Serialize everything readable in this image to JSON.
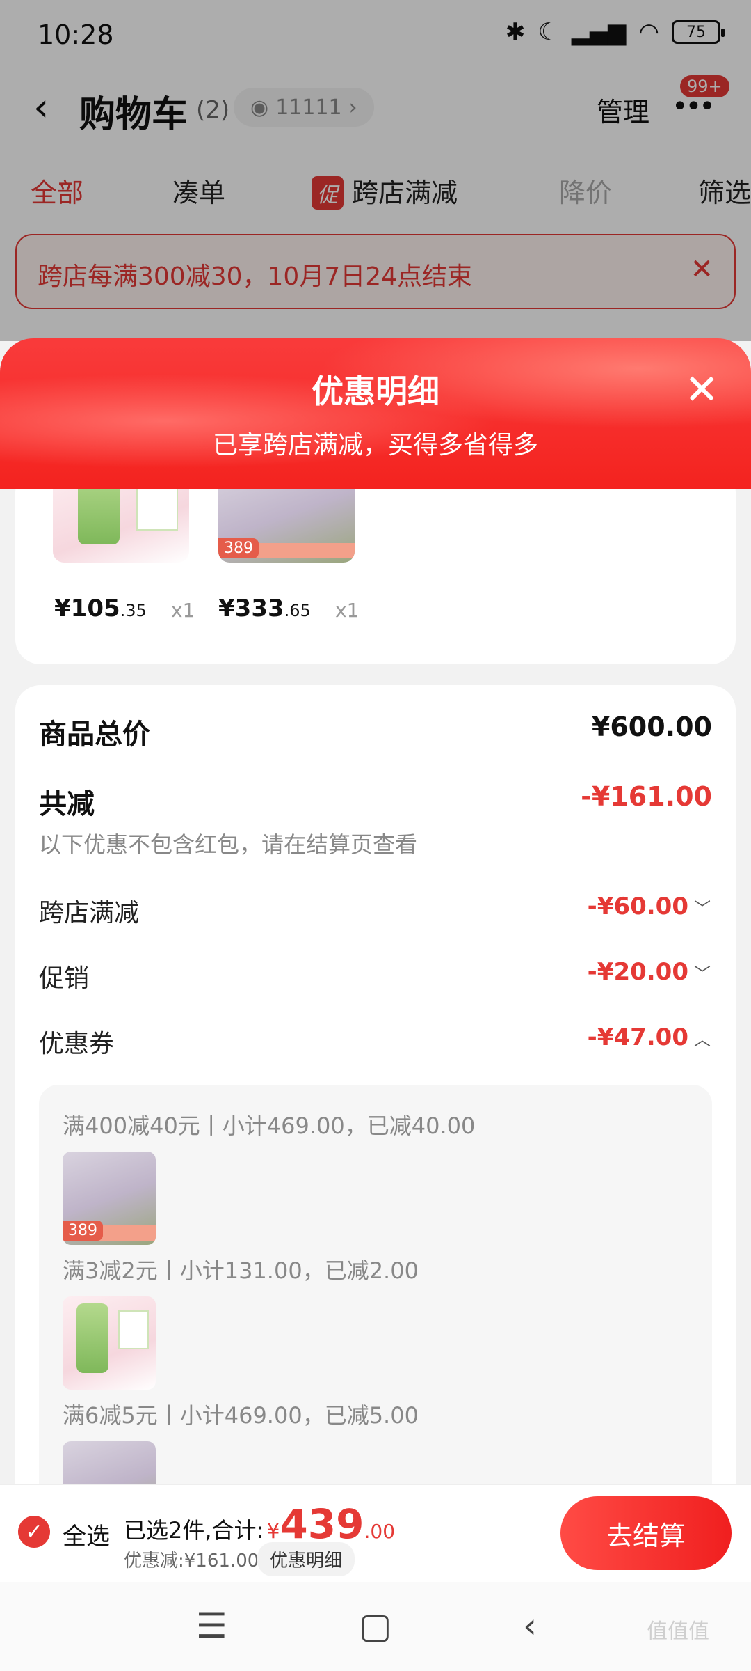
{
  "status_bar": {
    "time": "10:28",
    "battery": "75"
  },
  "nav": {
    "title": "购物车",
    "count": "(2)",
    "follow_count": "11111",
    "manage": "管理",
    "badge": "99+"
  },
  "tabs": [
    {
      "label": "全部",
      "state": "active"
    },
    {
      "label": "凑单",
      "state": "normal"
    },
    {
      "label": "跨店满减",
      "state": "normal",
      "tag": "促"
    },
    {
      "label": "降价",
      "state": "disabled"
    },
    {
      "label": "筛选",
      "state": "normal"
    }
  ],
  "notice": {
    "text": "跨店每满300减30，10月7日24点结束"
  },
  "sheet": {
    "title": "优惠明细",
    "subtitle": "已享跨店满减，买得多省得多"
  },
  "products": [
    {
      "price_int": "¥105",
      "price_dec": ".35",
      "qty": "x1"
    },
    {
      "price_int": "¥333",
      "price_dec": ".65",
      "qty": "x1"
    }
  ],
  "product_thumb_text": {
    "tag": "389"
  },
  "summary": {
    "total_label": "商品总价",
    "total_value": "¥600.00",
    "reduce_label": "共减",
    "reduce_value": "-¥161.00",
    "note": "以下优惠不包含红包，请在结算页查看",
    "items": [
      {
        "label": "跨店满减",
        "value": "-¥60.00"
      },
      {
        "label": "促销",
        "value": "-¥20.00"
      },
      {
        "label": "优惠券",
        "value": "-¥47.00"
      }
    ]
  },
  "coupons": [
    {
      "text": "满400减40元丨小计469.00，已减40.00"
    },
    {
      "text": "满3减2元丨小计131.00，已减2.00"
    },
    {
      "text": "满6减5元丨小计469.00，已减5.00"
    }
  ],
  "checkout": {
    "select_all": "全选",
    "selected_text": "已选2件,合计:",
    "currency": "¥",
    "total_int": "439",
    "total_dec": ".00",
    "discount_text": "优惠减:¥161.00",
    "detail_button": "优惠明细",
    "checkout_button": "去结算"
  },
  "watermark": "值值值",
  "colors": {
    "accent": "#e53935",
    "sheet_header": "#f4231f"
  }
}
